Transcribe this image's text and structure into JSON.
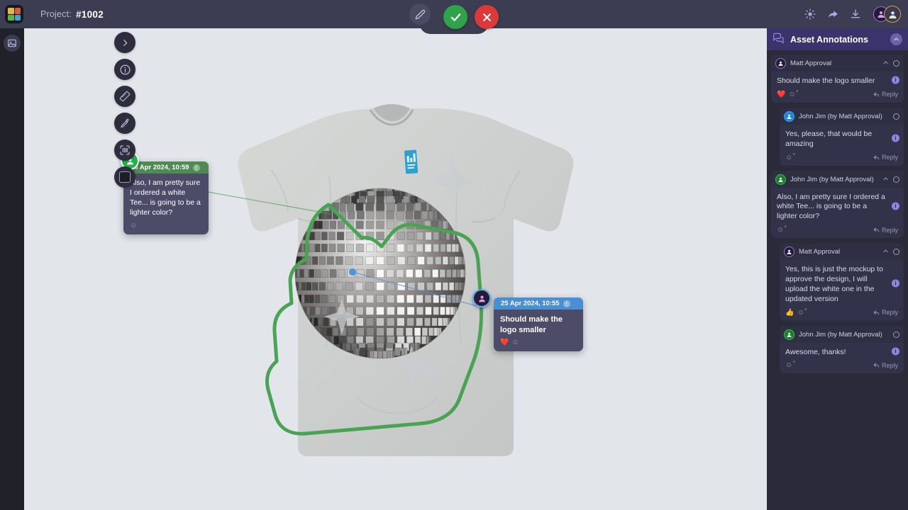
{
  "header": {
    "project_label": "Project:",
    "project_id": "#1002",
    "logo_name": "app-logo",
    "logo_colors": [
      "#e8b83a",
      "#e05a3a",
      "#3aa3d8",
      "#5ab84a"
    ],
    "edit_icon": "pencil-icon",
    "approve_label": "approve",
    "reject_label": "reject",
    "approve_color": "#2ea34a",
    "reject_color": "#dc3a3a",
    "right_icons": [
      "brightness-icon",
      "share-icon",
      "download-icon"
    ],
    "avatars": [
      "user-avatar-matt",
      "user-avatar-account"
    ]
  },
  "left_rail": {
    "items": [
      {
        "name": "image-asset-icon",
        "label": "Image asset"
      }
    ]
  },
  "tools": {
    "items": [
      {
        "name": "expand-chevron-icon",
        "label": "Expand panel"
      },
      {
        "name": "info-icon",
        "label": "Info"
      },
      {
        "name": "ruler-icon",
        "label": "Measure"
      },
      {
        "name": "eyedropper-icon",
        "label": "Color picker"
      },
      {
        "name": "scan-frame-icon",
        "label": "Crop / scan"
      },
      {
        "name": "color-swatch-icon",
        "label": "Swatch"
      }
    ]
  },
  "canvas": {
    "background": "#e2e6ea",
    "asset_alt": "Grey t-shirt mockup with disco ball print",
    "annotation_path_color": "#4aa354",
    "collar_tag_color": "#2f9fd0"
  },
  "pins": [
    {
      "id": "pin-green",
      "avatar_name": "pin-avatar-john-jim",
      "timestamp": "25 Apr 2024, 10:59",
      "accent": "green",
      "text": "Also, I am pretty sure I ordered a white Tee... is going to be a lighter color?",
      "bold": false,
      "reactions": [],
      "emoji_add": "☺"
    },
    {
      "id": "pin-blue",
      "avatar_name": "pin-avatar-matt-approval",
      "timestamp": "25 Apr 2024, 10:55",
      "accent": "blue",
      "text": "Should make the logo smaller",
      "bold": true,
      "reactions": [
        "❤"
      ],
      "emoji_add": "☺"
    }
  ],
  "panel": {
    "title": "Asset Annotations",
    "icon": "comments-icon",
    "collapse_icon": "chevron-up-icon",
    "accent": "#3b336b",
    "reply_label": "Reply",
    "emoji_add": "☺",
    "cards": [
      {
        "author": "Matt Approval",
        "avatar": "purple",
        "avatar_name": "avatar-matt-approval",
        "is_reply": false,
        "has_chevron": true,
        "text": "Should make the logo smaller",
        "reactions": [
          "❤"
        ]
      },
      {
        "author": "John Jim (by Matt Approval)",
        "avatar": "blue",
        "avatar_name": "avatar-john-jim",
        "is_reply": true,
        "has_chevron": false,
        "text": "Yes, please, that would be amazing",
        "reactions": []
      },
      {
        "author": "John Jim (by Matt Approval)",
        "avatar": "green",
        "avatar_name": "avatar-john-jim-green",
        "is_reply": false,
        "has_chevron": true,
        "text": "Also, I am pretty sure I ordered a white Tee... is going to be a lighter color?",
        "reactions": []
      },
      {
        "author": "Matt Approval",
        "avatar": "purple",
        "avatar_name": "avatar-matt-approval",
        "is_reply": true,
        "has_chevron": true,
        "text": "Yes, this is just the mockup to approve the design, I will upload the white one in the updated version",
        "reactions": [
          "👍"
        ]
      },
      {
        "author": "John Jim (by Matt Approval)",
        "avatar": "green",
        "avatar_name": "avatar-john-jim-green",
        "is_reply": true,
        "has_chevron": false,
        "text": "Awesome, thanks!",
        "reactions": []
      }
    ]
  }
}
